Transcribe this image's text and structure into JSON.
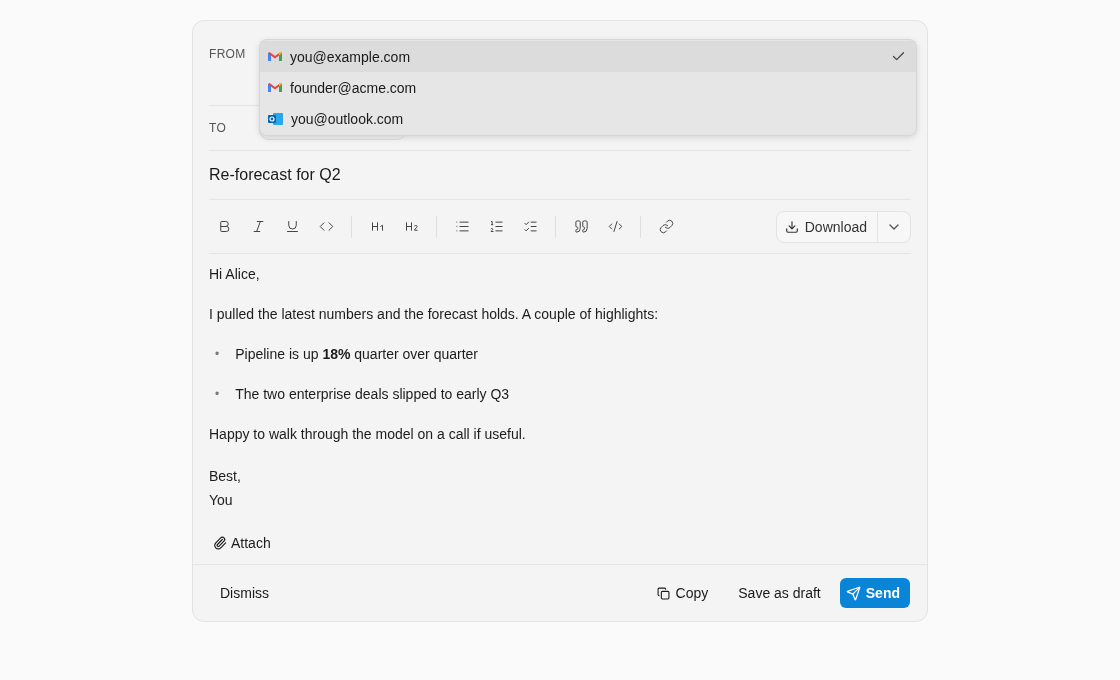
{
  "from": {
    "label": "FROM",
    "options": [
      {
        "address": "you@example.com",
        "kind": "gmail",
        "selected": true
      },
      {
        "address": "founder@acme.com",
        "kind": "gmail",
        "selected": false
      },
      {
        "address": "you@outlook.com",
        "kind": "outlook",
        "selected": false
      }
    ]
  },
  "to": {
    "label": "TO"
  },
  "subject": "Re-forecast for Q2",
  "toolbar": {
    "download": "Download"
  },
  "body": [
    {
      "kind": "paragraph",
      "text": "Hi Alice,"
    },
    {
      "kind": "paragraph",
      "text": "I pulled the latest numbers and the forecast holds. A couple of highlights:"
    },
    {
      "kind": "bullet",
      "marker": "•",
      "text": "Pipeline is up **18%** quarter over quarter"
    },
    {
      "kind": "bullet",
      "marker": "•",
      "text": "The two enterprise deals slipped to early Q3"
    },
    {
      "kind": "paragraph",
      "text": "Happy to walk through the model on a call if useful."
    },
    {
      "kind": "lines",
      "lines": [
        "Best,",
        "You"
      ]
    }
  ],
  "attach": "Attach",
  "footer": {
    "dismiss": "Dismiss",
    "copy": "Copy",
    "draft": "Save as draft",
    "send": "Send"
  }
}
